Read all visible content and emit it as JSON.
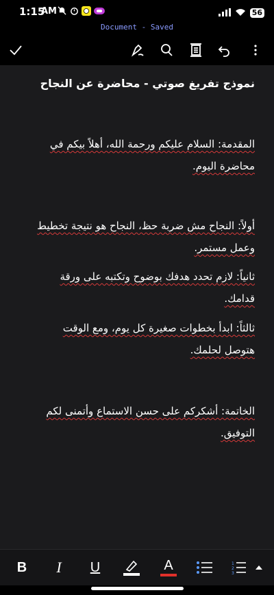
{
  "status_bar": {
    "time": "1:15",
    "ampm": "AM",
    "battery": "56"
  },
  "document_status": "Document - Saved",
  "toolbar": {
    "icons": [
      "checkmark-icon",
      "pen-draw-icon",
      "search-icon",
      "document-view-icon",
      "undo-icon",
      "more-vertical-icon"
    ]
  },
  "document": {
    "title": "نموذج تفريغ صوتي - محاضرة عن النجاح",
    "lines": [
      "المقدمة: السلام عليكم ورحمة الله، أهلاً بيكم في",
      "محاضرة اليوم.",
      "أولاً: النجاح مش ضربة حظ، النجاح هو نتيجة تخطيط",
      "وعمل مستمر.",
      "ثانياً: لازم تحدد هدفك بوضوح وتكتبه على ورقة",
      "قدامك.",
      "ثالثاً: ابدأ بخطوات صغيرة كل يوم، ومع الوقت",
      "هتوصل لحلمك.",
      "الخاتمة: أشكركم على حسن الاستماع وأتمنى لكم",
      "التوفيق."
    ]
  },
  "format_bar": {
    "bold": "B",
    "italic": "I",
    "underline": "U",
    "font_color": "A",
    "highlight_color": "#ffffff",
    "font_color_accent": "#e0302a"
  },
  "colors": {
    "accent_status": "#8a9bff",
    "doc_background": "#1b1b1d",
    "spellcheck": "#d73a3a"
  }
}
